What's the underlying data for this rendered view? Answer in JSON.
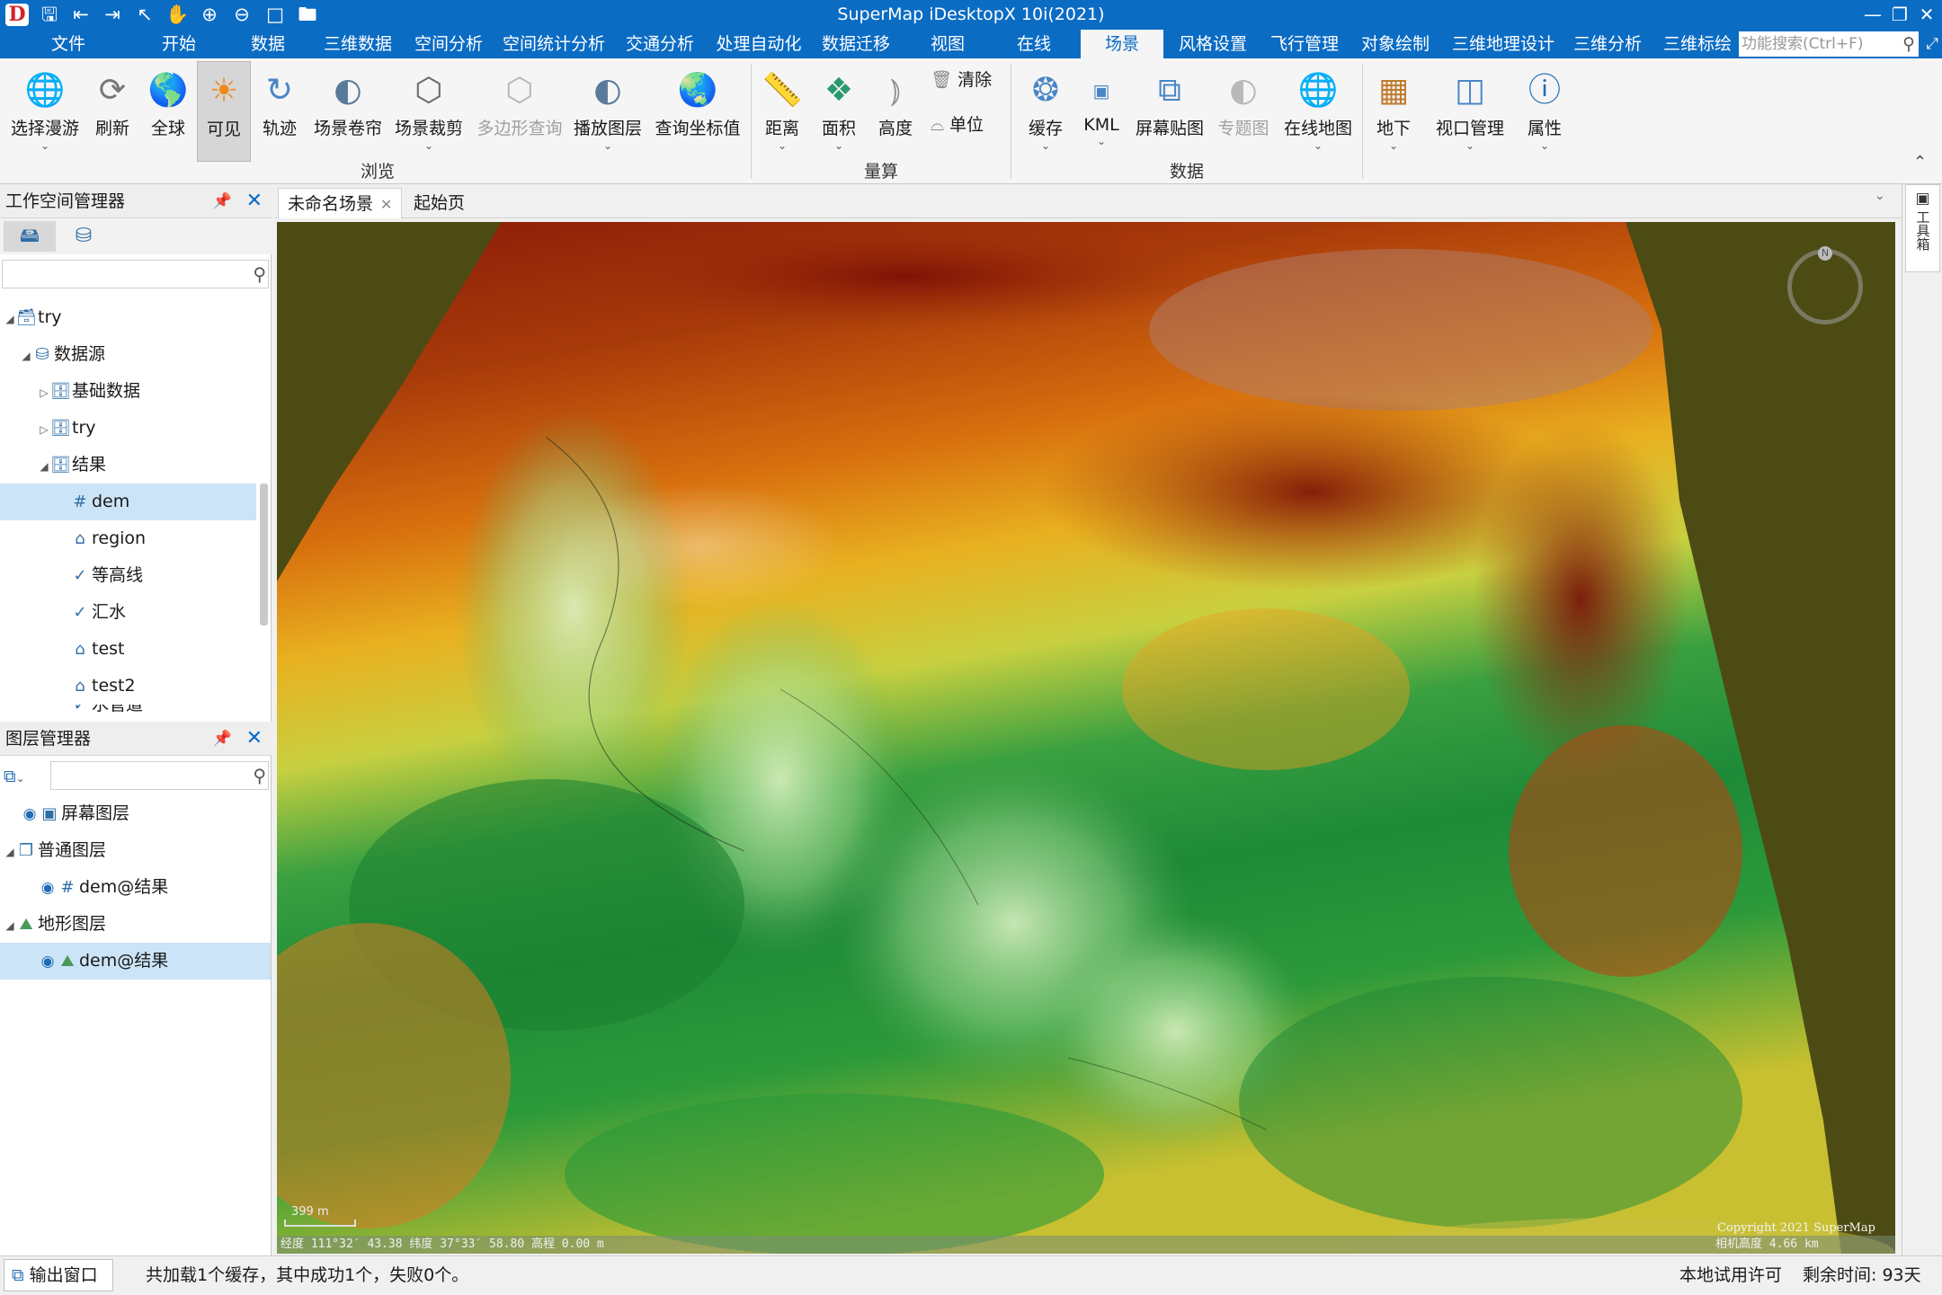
{
  "title": "SuperMap iDesktopX 10i(2021)",
  "menu": [
    "文件",
    "开始",
    "数据",
    "三维数据",
    "空间分析",
    "空间统计分析",
    "交通分析",
    "处理自动化",
    "数据迁移",
    "视图",
    "在线",
    "场景",
    "风格设置",
    "飞行管理",
    "对象绘制",
    "三维地理设计",
    "三维分析",
    "三维标绘"
  ],
  "active_menu": "场景",
  "search_placeholder": "功能搜索(Ctrl+F)",
  "ribbon": {
    "buttons": [
      "选择漫游",
      "刷新",
      "全球",
      "可见",
      "轨迹",
      "场景卷帘",
      "场景裁剪",
      "多边形查询",
      "播放图层",
      "查询坐标值",
      "距离",
      "面积",
      "高度",
      "缓存",
      "KML",
      "屏幕贴图",
      "专题图",
      "在线地图",
      "地下",
      "视口管理",
      "属性"
    ],
    "small_buttons": [
      "清除",
      "单位"
    ],
    "groups": [
      "浏览",
      "量算",
      "数据"
    ]
  },
  "workspace_panel": {
    "title": "工作空间管理器",
    "tree": [
      "try",
      "数据源",
      "基础数据",
      "try",
      "结果",
      "dem",
      "region",
      "等高线",
      "汇水",
      "test",
      "test2",
      "水管道"
    ]
  },
  "layer_panel": {
    "title": "图层管理器",
    "tree": [
      "屏幕图层",
      "普通图层",
      "dem@结果",
      "地形图层",
      "dem@结果"
    ]
  },
  "doc_tabs": [
    "未命名场景",
    "起始页"
  ],
  "right_panel_tab": "工具箱",
  "scene": {
    "scale_label": "399 m",
    "coords": "经度 111°32′ 43.38  纬度 37°33′ 58.80  高程 0.00 m",
    "copyright": "Copyright 2021 SuperMap",
    "camera_height": "相机高度 4.66 km",
    "compass_label": "N"
  },
  "status": {
    "output_window": "输出窗口",
    "message": "共加载1个缓存，其中成功1个，失败0个。",
    "license": "本地试用许可",
    "remaining": "剩余时间: 93天"
  }
}
